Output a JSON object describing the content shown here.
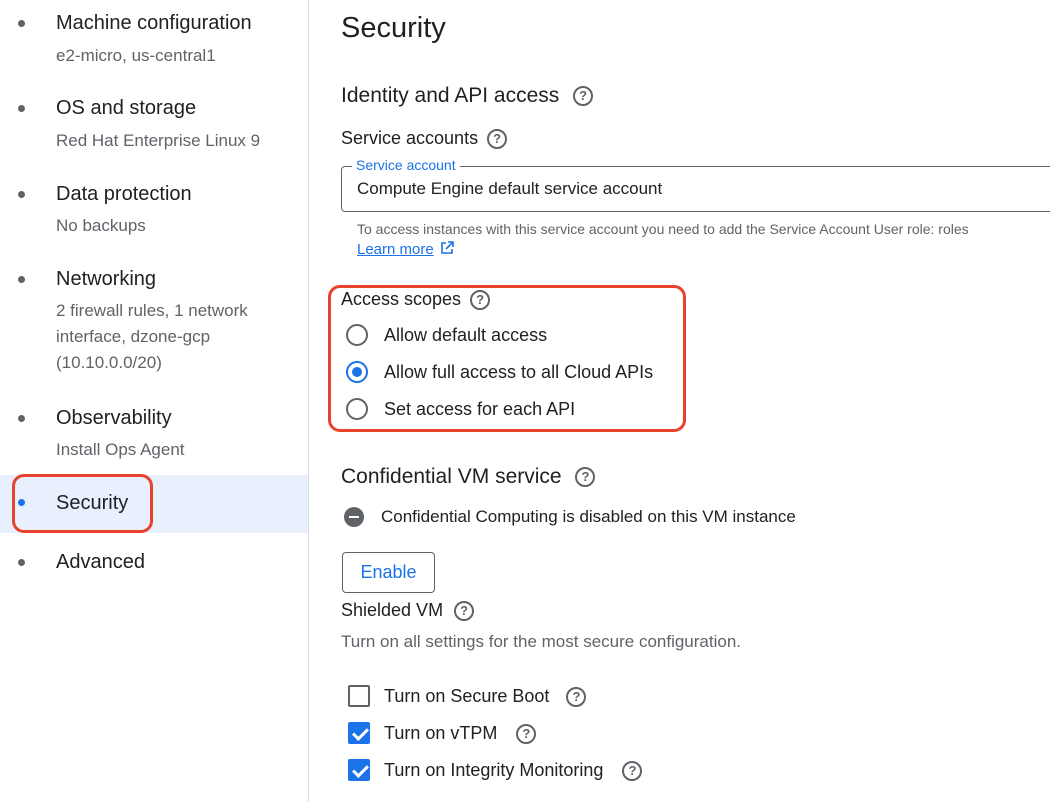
{
  "sidebar": {
    "items": [
      {
        "label": "Machine configuration",
        "sub": "e2-micro, us-central1"
      },
      {
        "label": "OS and storage",
        "sub": "Red Hat Enterprise Linux 9"
      },
      {
        "label": "Data protection",
        "sub": "No backups"
      },
      {
        "label": "Networking",
        "sub": "2 firewall rules, 1 network interface, dzone-gcp (10.10.0.0/20)"
      },
      {
        "label": "Observability",
        "sub": "Install Ops Agent"
      },
      {
        "label": "Security",
        "sub": ""
      },
      {
        "label": "Advanced",
        "sub": ""
      }
    ],
    "active_index": 5
  },
  "main": {
    "title": "Security",
    "identity": {
      "heading": "Identity and API access",
      "service_accounts_label": "Service accounts",
      "field_legend": "Service account",
      "field_value": "Compute Engine default service account",
      "hint": "To access instances with this service account you need to add the Service Account User role: roles",
      "learn_more": "Learn more"
    },
    "access_scopes": {
      "label": "Access scopes",
      "options": [
        {
          "label": "Allow default access",
          "selected": false
        },
        {
          "label": "Allow full access to all Cloud APIs",
          "selected": true
        },
        {
          "label": "Set access for each API",
          "selected": false
        }
      ]
    },
    "confidential": {
      "heading": "Confidential VM service",
      "status": "Confidential Computing is disabled on this VM instance",
      "enable_label": "Enable"
    },
    "shielded": {
      "heading": "Shielded VM",
      "description": "Turn on all settings for the most secure configuration.",
      "options": [
        {
          "label": "Turn on Secure Boot",
          "checked": false
        },
        {
          "label": "Turn on vTPM",
          "checked": true
        },
        {
          "label": "Turn on Integrity Monitoring",
          "checked": true
        }
      ]
    }
  },
  "colors": {
    "accent": "#1a73e8",
    "highlight": "#e8412c",
    "active_bg": "#e8f0fe"
  },
  "icons": {
    "help": "help-circle-icon",
    "external": "open-in-new-icon",
    "status": "minus-circle-icon"
  }
}
